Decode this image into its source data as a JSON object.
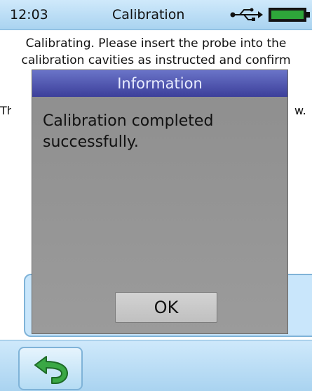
{
  "status": {
    "time": "12:03",
    "title": "Calibration",
    "usb_icon": "usb-icon",
    "battery_icon": "battery-icon"
  },
  "background": {
    "instruction_line1": "Calibrating. Please insert the probe into the",
    "instruction_line2": "calibration cavities as instructed and confirm",
    "partial_left": "Th",
    "partial_right": "w."
  },
  "dialog": {
    "title": "Information",
    "message": "Calibration completed successfully.",
    "ok_label": "OK"
  },
  "bottombar": {
    "back_icon": "back-arrow-icon"
  },
  "colors": {
    "bar_blue": "#a9d3f0",
    "dialog_header": "#3c3f9a",
    "dialog_body": "#959595"
  }
}
